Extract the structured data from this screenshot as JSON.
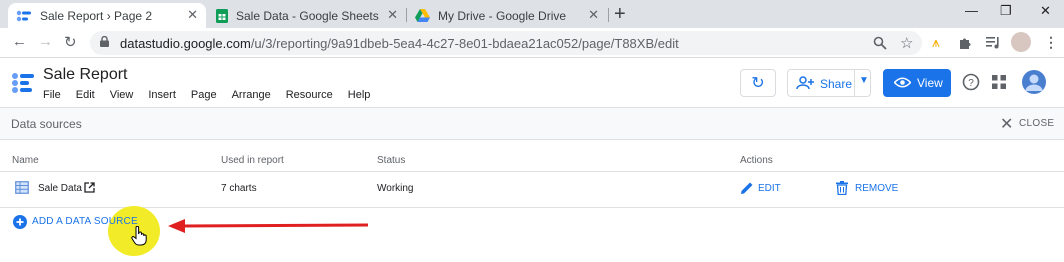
{
  "browser": {
    "tabs": [
      {
        "title": "Sale Report › Page 2",
        "icon": "data-studio-icon",
        "active": true
      },
      {
        "title": "Sale Data - Google Sheets",
        "icon": "sheets-icon",
        "active": false
      },
      {
        "title": "My Drive - Google Drive",
        "icon": "drive-icon",
        "active": false
      }
    ],
    "url_host": "datastudio.google.com",
    "url_path": "/u/3/reporting/9a91dbeb-5ea4-4c27-8e01-bdaea21ac052/page/T88XB/edit"
  },
  "app": {
    "title": "Sale Report",
    "menu": [
      "File",
      "Edit",
      "View",
      "Insert",
      "Page",
      "Arrange",
      "Resource",
      "Help"
    ],
    "share_label": "Share",
    "view_label": "View"
  },
  "panel": {
    "title": "Data sources",
    "close_label": "CLOSE",
    "columns": {
      "name": "Name",
      "used": "Used in report",
      "status": "Status",
      "actions": "Actions"
    },
    "rows": [
      {
        "name": "Sale Data",
        "used": "7 charts",
        "status": "Working",
        "edit_label": "EDIT",
        "remove_label": "REMOVE"
      }
    ],
    "add_label": "ADD A DATA SOURCE"
  },
  "colors": {
    "accent": "#1a73e8",
    "annotation_arrow": "#e02020",
    "cursor_highlight": "#f2ec28"
  }
}
